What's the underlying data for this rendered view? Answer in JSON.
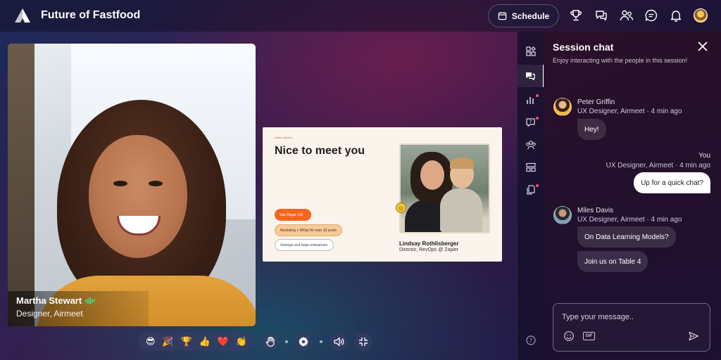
{
  "header": {
    "event_title": "Future of Fastfood",
    "schedule_label": "Schedule",
    "icons": [
      "trophy-icon",
      "chat-icon",
      "people-icon",
      "message-icon",
      "bell-icon"
    ]
  },
  "stage": {
    "speaker": {
      "name": "Martha Stewart",
      "role": "Designer, Airmeet"
    },
    "slide": {
      "kicker": "Nadia Matelus",
      "title": "Nice to meet you",
      "pills": [
        "San Diego, CA",
        "Marketing + MOps for over 10 years",
        "Startups and large enterprises"
      ],
      "person_name": "Lindsay Rothlisberger",
      "person_role": "Director, RevOps @ Zapier"
    },
    "reactions": [
      "😎",
      "🎉",
      "🏆",
      "👍",
      "❤️",
      "👏"
    ]
  },
  "rail": {
    "items": [
      "booths-icon",
      "chat-icon",
      "polls-icon",
      "qa-icon",
      "people-icon",
      "layout-icon",
      "files-icon",
      "help-icon"
    ]
  },
  "chat": {
    "title": "Session chat",
    "subtitle": "Enjoy interacting with the people in this session!",
    "messages": [
      {
        "sender": "Peter Griffin",
        "meta": "UX Designer, Airmeet · 4 min ago",
        "text": "Hey!"
      },
      {
        "sender": "You",
        "meta": "UX Designer, Airmeet · 4 min ago",
        "text": "Up for a quick chat?"
      },
      {
        "sender": "Miles Davis",
        "meta": "UX Designer, Airmeet · 4 min ago",
        "texts": [
          "On Data Learning Models?",
          "Join us on Table 4"
        ]
      }
    ],
    "composer_placeholder": "Type your message..",
    "gif_label": "GIF"
  },
  "colors": {
    "accent_green": "#3ddc84",
    "notification_dot": "#ff4d6a",
    "slide_orange": "#f2661e"
  }
}
